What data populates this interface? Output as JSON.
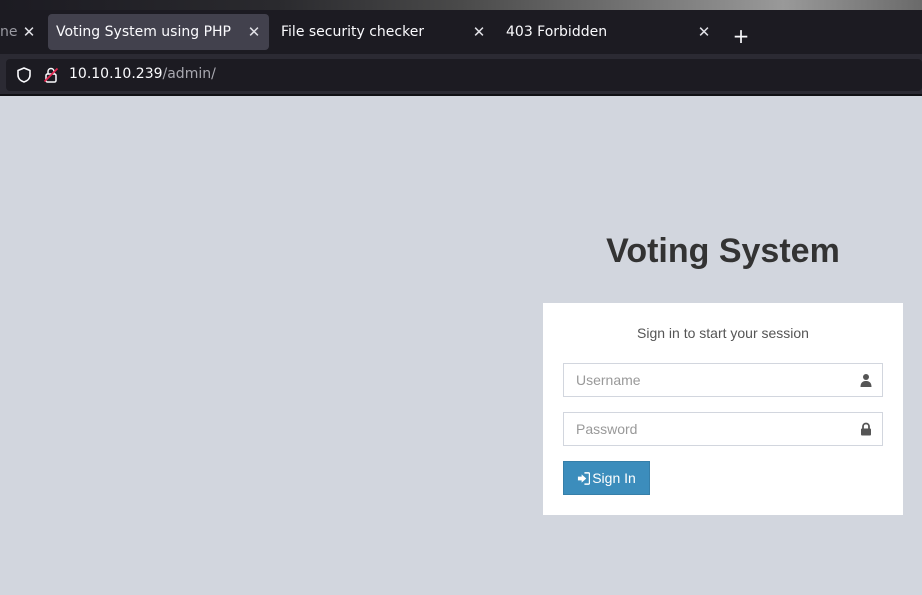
{
  "browser": {
    "tabs": [
      {
        "label": "ne",
        "active": false
      },
      {
        "label": "Voting System using PHP",
        "active": true
      },
      {
        "label": "File security checker",
        "active": false
      },
      {
        "label": "403 Forbidden",
        "active": false
      }
    ],
    "new_tab_icon": "plus-icon",
    "url": {
      "host": "10.10.10.239",
      "path": "/admin/"
    }
  },
  "page": {
    "title": "Voting System",
    "login": {
      "message": "Sign in to start your session",
      "username_placeholder": "Username",
      "password_placeholder": "Password",
      "submit_label": "Sign In"
    }
  },
  "colors": {
    "page_background": "#d2d6de",
    "button_primary": "#3c8dbc",
    "browser_chrome": "#1c1b22"
  }
}
